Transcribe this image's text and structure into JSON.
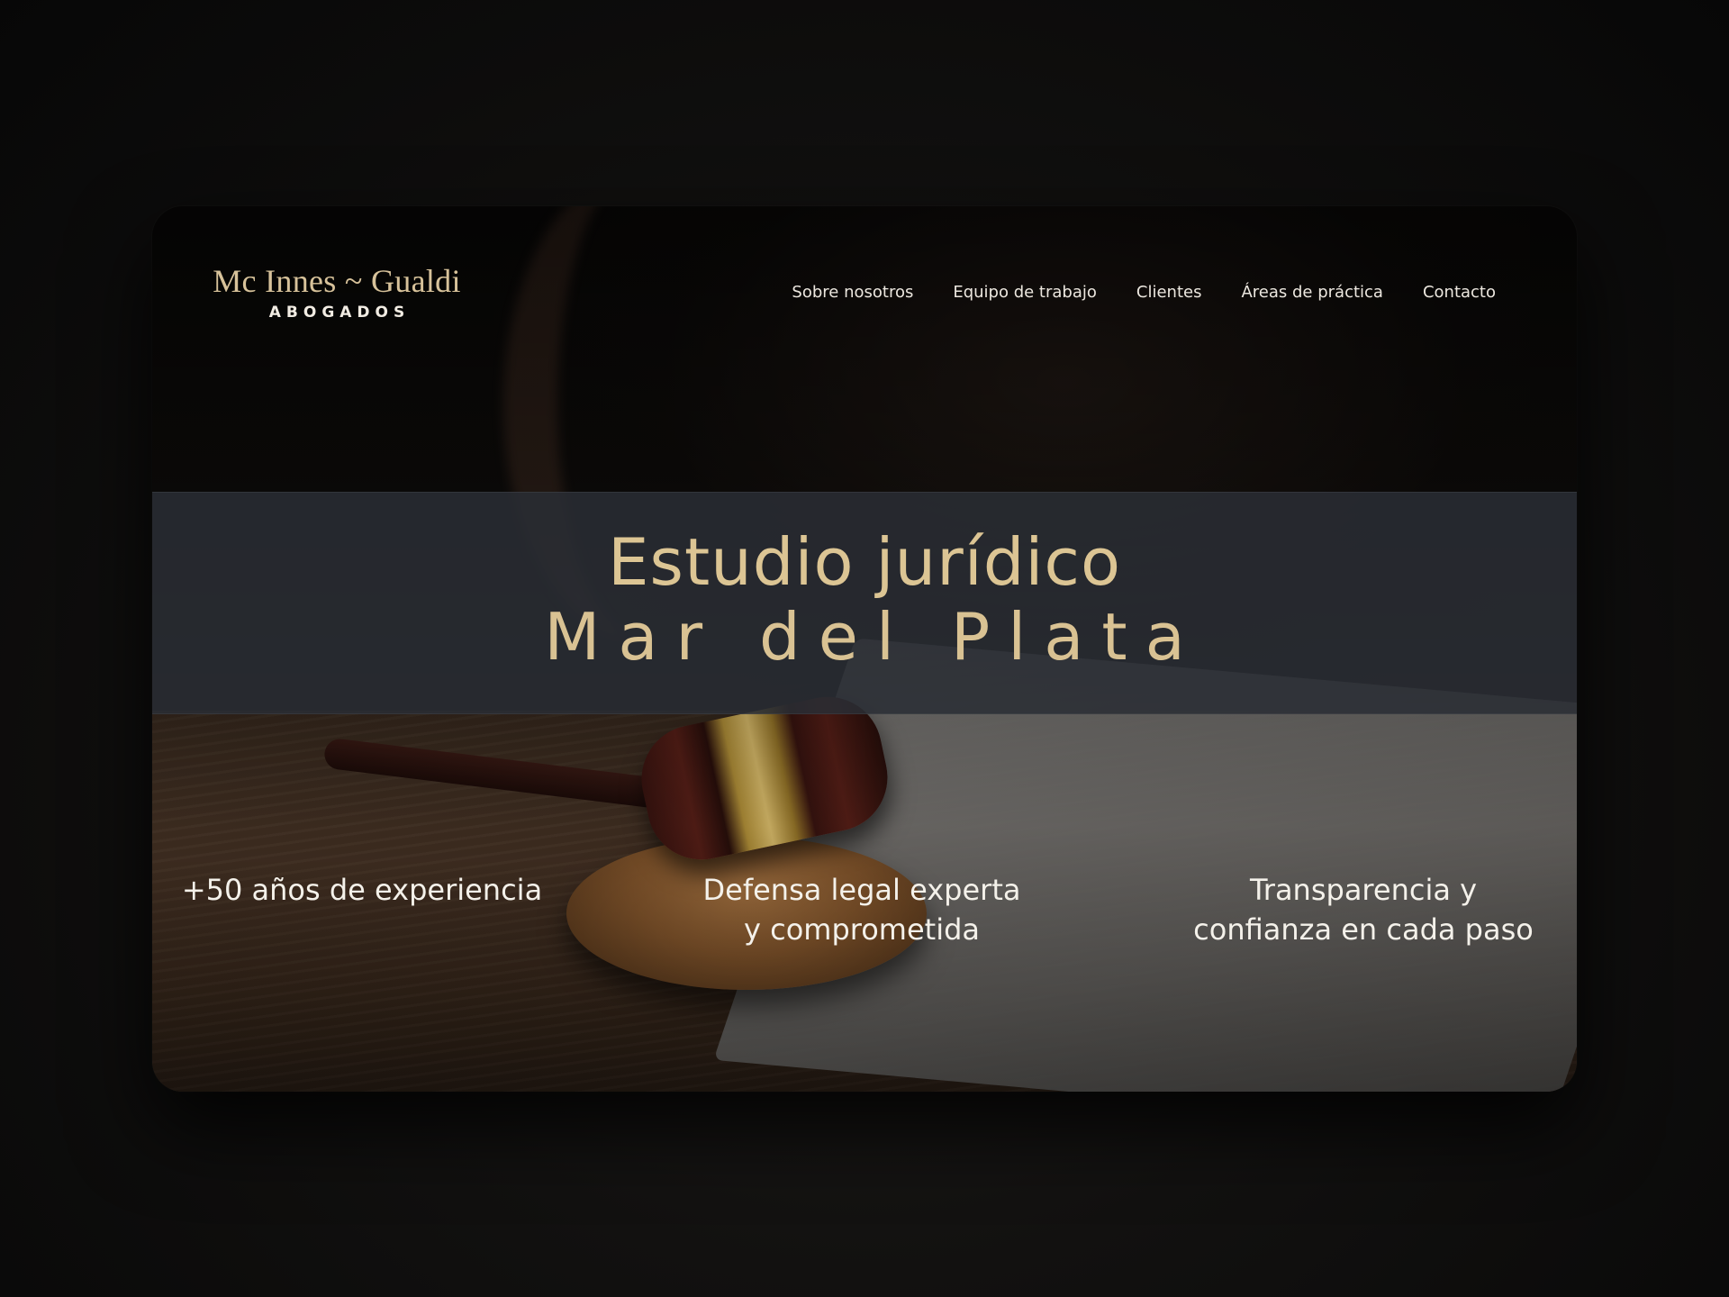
{
  "brand": {
    "name": "Mc Innes ~ Gualdi",
    "tagline": "ABOGADOS"
  },
  "nav": {
    "items": [
      {
        "label": "Sobre nosotros"
      },
      {
        "label": "Equipo de trabajo"
      },
      {
        "label": "Clientes"
      },
      {
        "label": "Áreas de práctica"
      },
      {
        "label": "Contacto"
      }
    ]
  },
  "hero": {
    "title": "Estudio jurídico",
    "subtitle": "Mar del Plata"
  },
  "features": [
    {
      "text": "+50 años de experiencia"
    },
    {
      "text": "Defensa legal experta\ny comprometida"
    },
    {
      "text": "Transparencia y\nconfianza en cada paso"
    }
  ],
  "colors": {
    "accent_gold": "#dcc594",
    "band": "#2a2d34",
    "text_light": "#f4f1ea"
  }
}
